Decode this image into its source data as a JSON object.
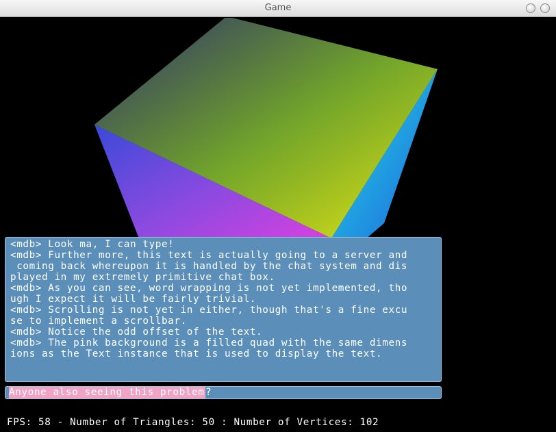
{
  "window": {
    "title": "Game"
  },
  "chat": {
    "lines": [
      "<mdb> Look ma, I can type!",
      "<mdb> Further more, this text is actually going to a server and",
      " coming back whereupon it is handled by the chat system and dis",
      "played in my extremely primitive chat box.",
      "<mdb> As you can see, word wrapping is not yet implemented, tho",
      "ugh I expect it will be fairly trivial.",
      "<mdb> Scrolling is not yet in either, though that's a fine excu",
      "se to implement a scrollbar.",
      "<mdb> Notice the odd offset of the text.",
      "<mdb> The pink background is a filled quad with the same dimens",
      "ions as the Text instance that is used to display the text."
    ]
  },
  "input": {
    "value": "Anyone also seeing this problem",
    "caret": "?"
  },
  "stats": {
    "text": "FPS: 58 - Number of Triangles: 50 : Number of Vertices: 102"
  },
  "colors": {
    "panel": "#5b8fb9",
    "panel_border": "#9ec3de",
    "input_highlight": "#f0a3c4"
  }
}
